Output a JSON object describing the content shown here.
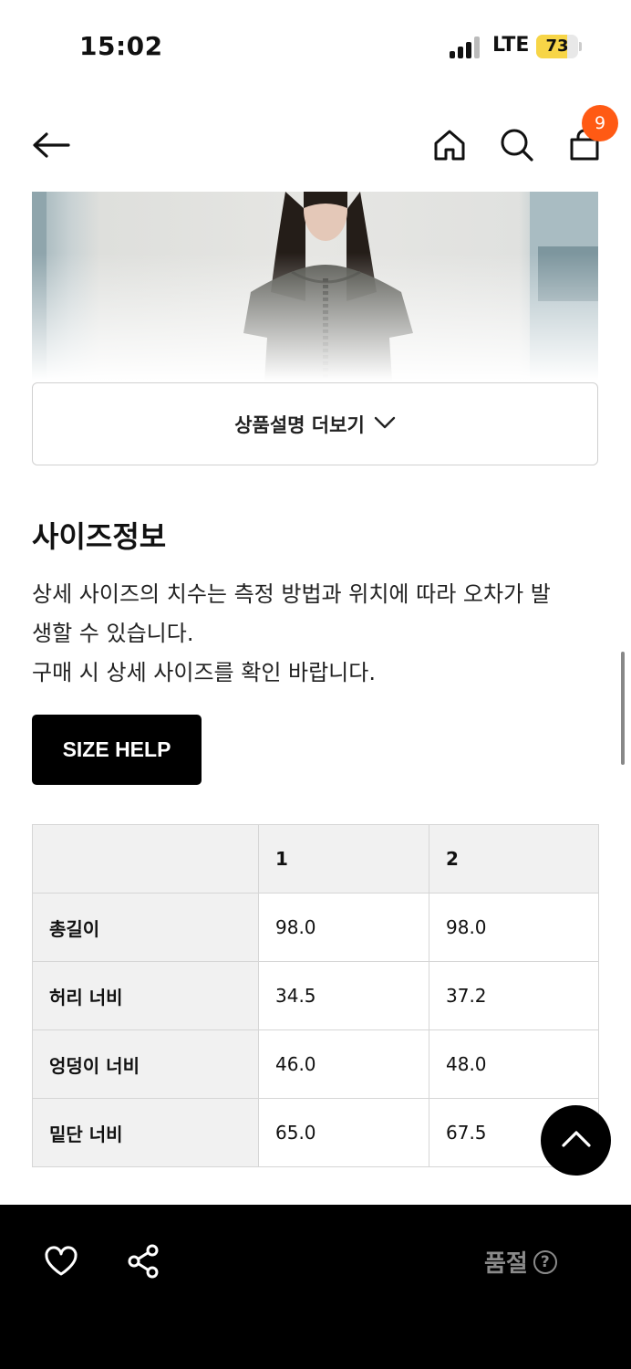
{
  "status_bar": {
    "time": "15:02",
    "network": "LTE",
    "battery_percent": "73",
    "battery_level": 0.73,
    "battery_color": "#f7d547"
  },
  "nav": {
    "back_icon": "arrow-left-icon",
    "home_icon": "home-icon",
    "search_icon": "search-icon",
    "cart_icon": "shopping-bag-icon",
    "cart_count": "9",
    "badge_color": "#ff5a14"
  },
  "product": {
    "more_label": "상품설명 더보기",
    "more_icon": "chevron-down-icon"
  },
  "size_info": {
    "title": "사이즈정보",
    "description_lines": [
      "상세 사이즈의 치수는 측정 방법과 위치에 따라 오차가 발",
      "생할 수 있습니다.",
      "구매 시 상세 사이즈를 확인 바랍니다."
    ],
    "help_button": "SIZE HELP",
    "table": {
      "headers": [
        "",
        "1",
        "2"
      ],
      "rows": [
        {
          "label": "총길이",
          "values": [
            "98.0",
            "98.0"
          ]
        },
        {
          "label": "허리 너비",
          "values": [
            "34.5",
            "37.2"
          ]
        },
        {
          "label": "엉덩이 너비",
          "values": [
            "46.0",
            "48.0"
          ]
        },
        {
          "label": "밑단 너비",
          "values": [
            "65.0",
            "67.5"
          ]
        }
      ]
    }
  },
  "scroll_top_icon": "chevron-up-icon",
  "bottom_bar": {
    "like_icon": "heart-icon",
    "share_icon": "share-icon",
    "status_label": "품절",
    "help_icon": "question-circle-icon",
    "help_glyph": "?"
  }
}
